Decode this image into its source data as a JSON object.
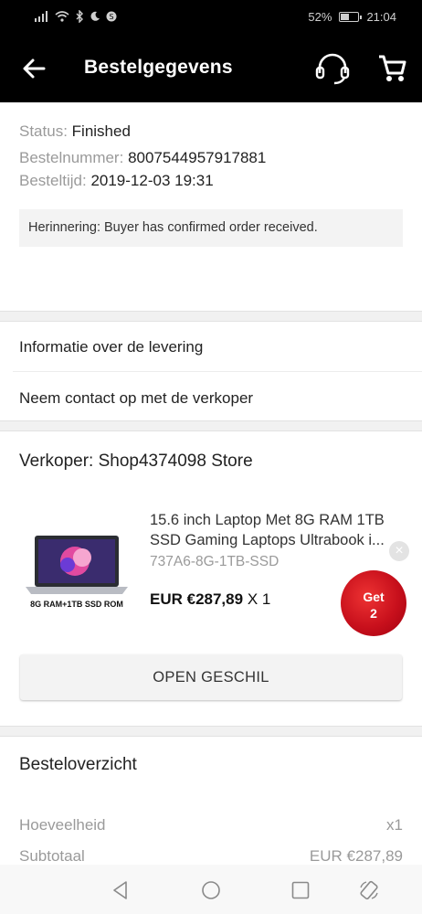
{
  "status_bar": {
    "battery": "52%",
    "battery_level": 0.52,
    "time": "21:04"
  },
  "header": {
    "title": "Bestelgegevens"
  },
  "icons": {
    "back": "arrow-left-icon",
    "support": "headset-icon",
    "cart": "cart-icon"
  },
  "order": {
    "status_label": "Status:",
    "status_value": "Finished",
    "number_label": "Bestelnummer:",
    "number_value": "8007544957917881",
    "time_label": "Besteltijd:",
    "time_value": "2019-12-03 19:31",
    "reminder": "Herinnering: Buyer has confirmed order received."
  },
  "links": {
    "delivery": "Informatie over de levering",
    "contact": "Neem contact op met de verkoper"
  },
  "seller": {
    "name": "Verkoper: Shop4374098 Store"
  },
  "product": {
    "title": "15.6 inch Laptop Met 8G RAM 1TB SSD Gaming Laptops Ultrabook i...",
    "sku": "737A6-8G-1TB-SSD",
    "price": "EUR €287,89",
    "qty": "X 1",
    "image_caption": "8G RAM+1TB SSD ROM"
  },
  "promo": {
    "line1": "Get",
    "line2": "2"
  },
  "dispute_button": "OPEN GESCHIL",
  "summary": {
    "title": "Besteloverzicht",
    "quantity_label": "Hoeveelheid",
    "quantity_value": "x1",
    "subtotal_label": "Subtotaal",
    "subtotal_value": "EUR €287,89"
  },
  "colors": {
    "header_bg": "#000000",
    "section_gap": "#f1f1f1",
    "promo_red": "#c8101c"
  }
}
